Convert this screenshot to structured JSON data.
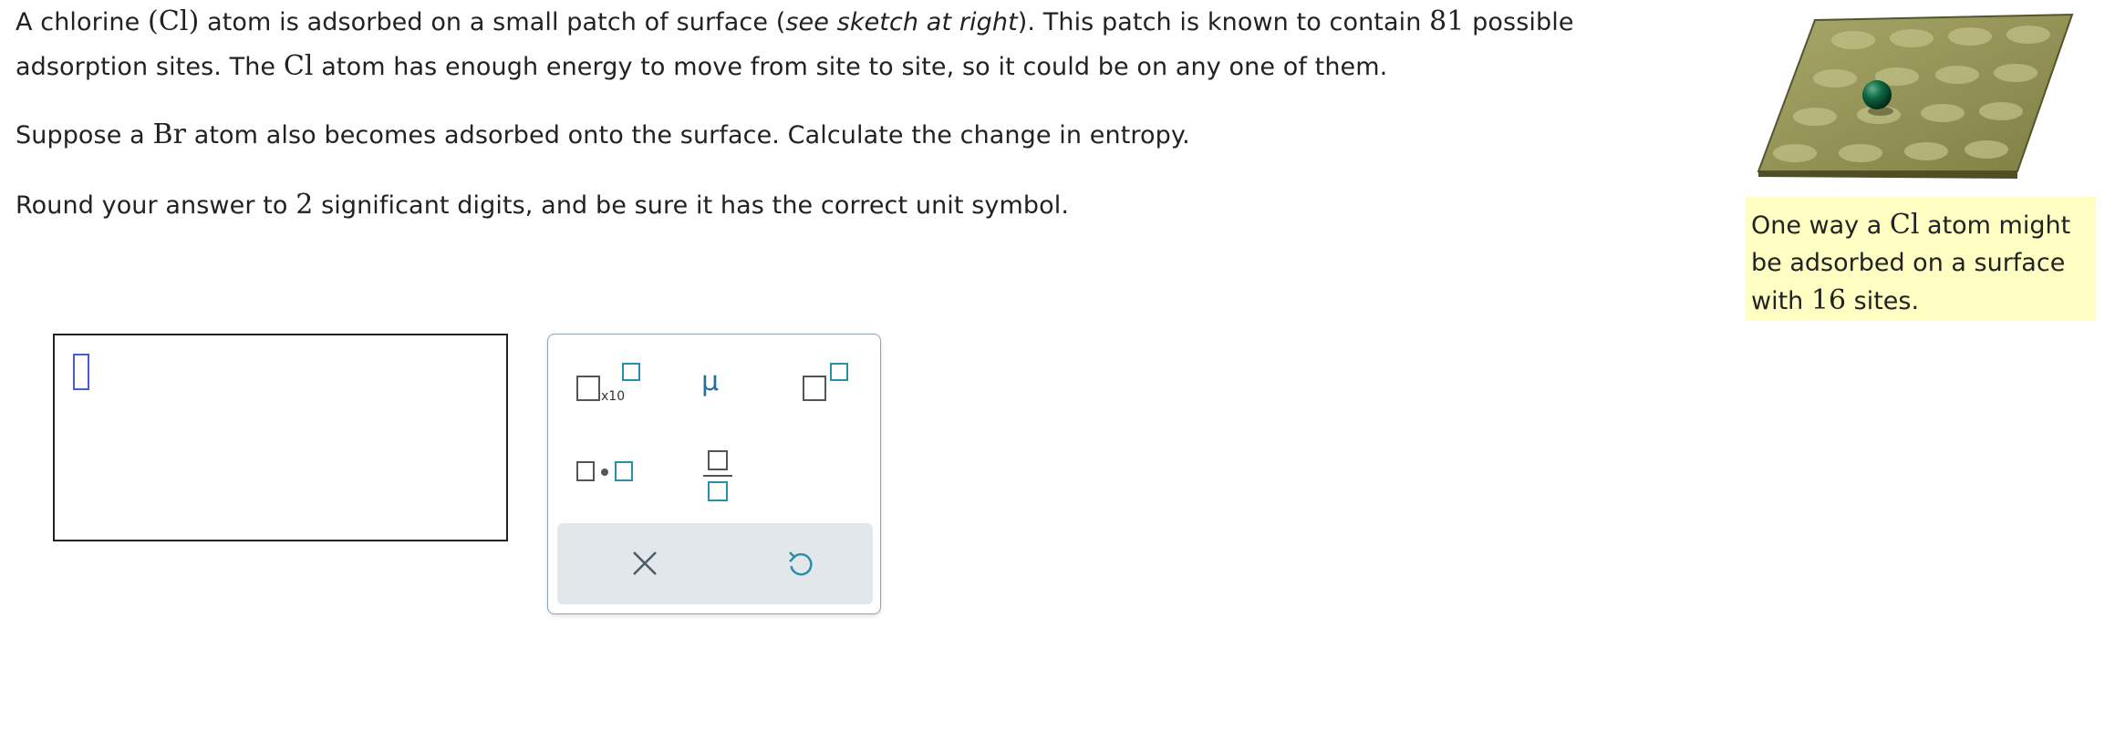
{
  "question": {
    "p1_a": "A chlorine ",
    "p1_cl": "(Cl)",
    "p1_b": "  atom is adsorbed on a small patch of surface (",
    "p1_italic": "see sketch at right",
    "p1_c": "). This patch is known to contain ",
    "p1_num": "81",
    "p1_d": " possible adsorption sites. The ",
    "p1_cl2": "Cl",
    "p1_e": " atom has enough energy to move from site to site, so it could be on any one of them.",
    "p2_a": "Suppose a ",
    "p2_br": "Br",
    "p2_b": " atom also becomes adsorbed onto the surface. Calculate the change in entropy.",
    "p3_a": "Round your answer to ",
    "p3_num": "2",
    "p3_b": " significant digits, and be sure it has the correct unit symbol."
  },
  "answer": {
    "value": ""
  },
  "palette": {
    "x10_label": "x10",
    "mu_label": "μ"
  },
  "caption": {
    "a": "One way a ",
    "cl": "Cl",
    "b": " atom might be adsorbed on a surface with ",
    "num": "16",
    "c": " sites."
  },
  "colors": {
    "accent": "#2a8fa8",
    "cursor": "#4a5bd9",
    "caption_bg": "#ffffc4",
    "surface": "#9a9a55",
    "atom": "#0d5a3a"
  }
}
